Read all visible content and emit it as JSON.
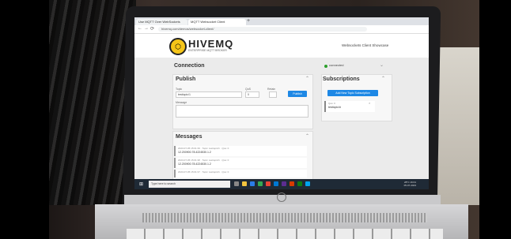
{
  "browser": {
    "tabs": [
      "Use MQTT Over WebSockets",
      "MQTT Websocket Client"
    ],
    "new_tab": "+",
    "nav": [
      "←",
      "→",
      "⟳"
    ],
    "url": "hivemq.com/demos/websocket-client/"
  },
  "app": {
    "brand": "HIVEMQ",
    "brand_sub": "ENTERPRISE MQTT BROKER",
    "client_title": "Websockets Client Showcase",
    "connection": {
      "title": "Connection",
      "status": "connected"
    },
    "publish": {
      "title": "Publish",
      "topic_label": "Topic",
      "topic_value": "testtopic/1",
      "qos_label": "QoS",
      "qos_value": "0",
      "retain_label": "Retain",
      "publish_button": "Publish",
      "message_label": "Message"
    },
    "subscriptions": {
      "title": "Subscriptions",
      "add_button": "Add New Topic Subscription",
      "items": [
        {
          "qos": "Qos: 0",
          "topic": "testtopic/#"
        }
      ]
    },
    "messages": {
      "title": "Messages",
      "items": [
        {
          "meta": "2023-07-05 15:01:39",
          "topic": "Topic: testtopic/1",
          "qos": "Qos: 0",
          "body": "12.200900.78.4224530.1.2"
        },
        {
          "meta": "2023-07-05 15:01:38",
          "topic": "Topic: testtopic/1",
          "qos": "Qos: 0",
          "body": "12.200900.78.4224530.1.2"
        },
        {
          "meta": "2023-07-05 15:01:37",
          "topic": "Topic: testtopic/1",
          "qos": "Qos: 0",
          "body": ""
        }
      ]
    }
  },
  "taskbar": {
    "search_placeholder": "Type here to search",
    "tray_temp": "28°C",
    "tray_time": "16:01",
    "tray_date": "05-07-2023"
  },
  "laptop": {
    "logo": "hp"
  },
  "colors": {
    "accent": "#1e88e5",
    "hive_yellow": "#f5c518",
    "connected": "#2ca02c"
  }
}
